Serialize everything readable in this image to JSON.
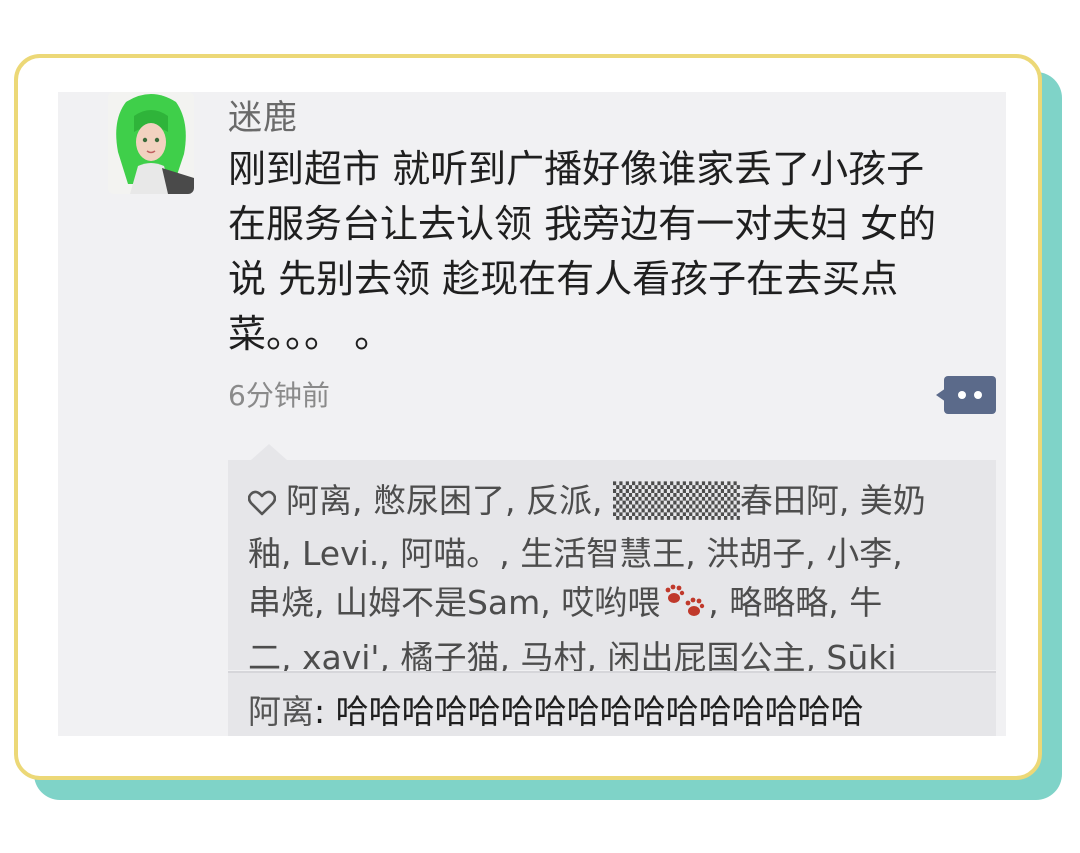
{
  "post": {
    "username": "迷鹿",
    "lines": [
      "刚到超市 就听到广播好像谁家丢了小孩子",
      "在服务台让去认领  我旁边有一对夫妇 女的",
      "说 先别去领 趁现在有人看孩子在去买点",
      "菜。。。 。"
    ],
    "timestamp": "6分钟前"
  },
  "likes": {
    "lines": [
      "阿离, 憋尿困了, 反派, ▒▒▒▒▒春田阿, 美奶",
      "釉, Levi., 阿喵。, 生活智慧王, 洪胡子, 小李,",
      "串烧, 山姆不是Sam, 哎哟喂",
      ", 略略略, 牛",
      "二, xavi', 橘子猫, 马村, 闲出屁国公主, Sūki"
    ]
  },
  "comment": {
    "author": "阿离",
    "separator": ": ",
    "text": "哈哈哈哈哈哈哈哈哈哈哈哈哈哈哈哈"
  },
  "colors": {
    "frame_border": "#ecd877",
    "frame_shadow": "#7fd3c8",
    "screenshot_bg": "#f1f1f3",
    "likes_bg": "#e6e6e9",
    "more_button": "#5b6a8a",
    "paw": "#c0392b"
  },
  "icons": {
    "heart": "heart-outline-icon",
    "more": "more-options-icon",
    "paw": "paw-emoji-icon"
  }
}
